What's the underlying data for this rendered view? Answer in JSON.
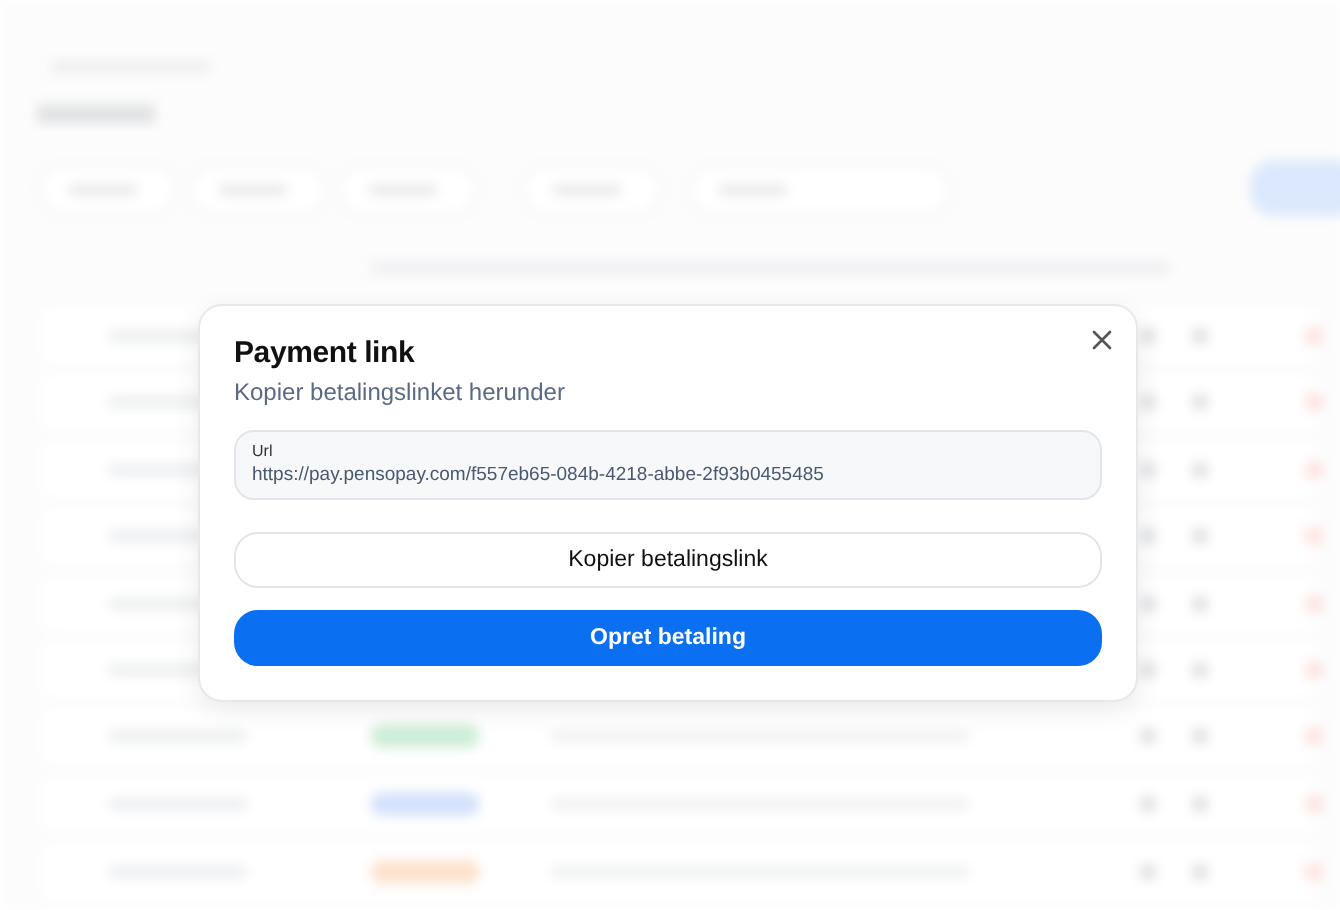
{
  "dialog": {
    "title": "Payment link",
    "subtitle": "Kopier betalingslinket herunder",
    "url_field": {
      "label": "Url",
      "value": "https://pay.pensopay.com/f557eb65-084b-4218-abbe-2f93b0455485"
    },
    "buttons": [
      {
        "label": "Kopier betalingslink",
        "kind": "secondary"
      },
      {
        "label": "Opret betaling",
        "kind": "primary"
      }
    ]
  }
}
